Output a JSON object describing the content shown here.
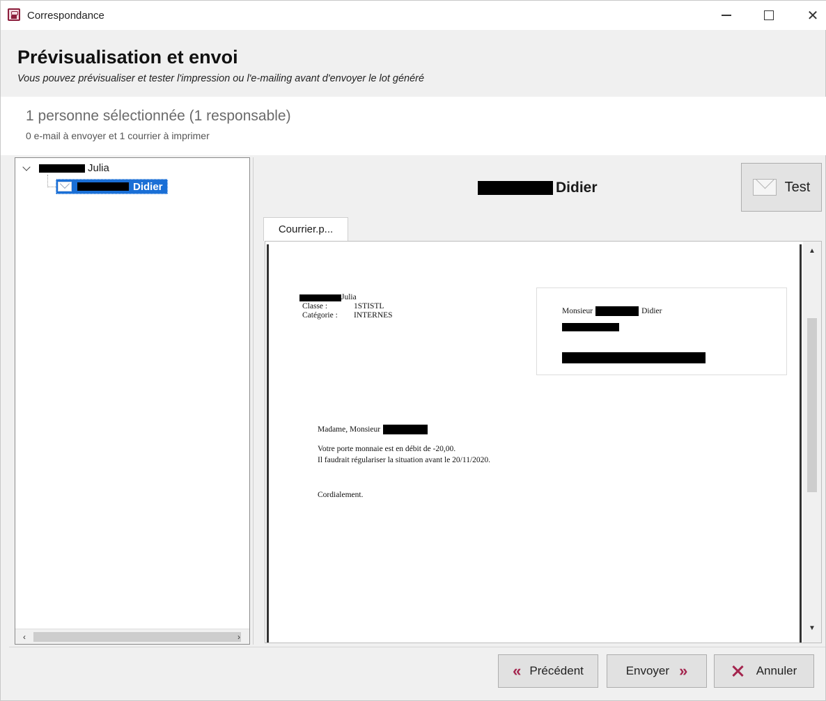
{
  "window": {
    "title": "Correspondance",
    "minimize_glyph": "",
    "close_glyph": "✕"
  },
  "header": {
    "title": "Prévisualisation et envoi",
    "subtitle": "Vous pouvez prévisualiser et tester l'impression ou l'e-mailing avant d'envoyer le lot généré"
  },
  "summary": {
    "main": "1 personne sélectionnée (1 responsable)",
    "detail": "0 e-mail à envoyer et 1 courrier à imprimer"
  },
  "tree": {
    "parent_label": "Julia",
    "child_label": "Didier",
    "scroll_left": "‹",
    "scroll_right": "›"
  },
  "preview": {
    "recipient_name": "Didier",
    "test_label": "Test",
    "tab_label": "Courrier.p...",
    "scroll_up": "▲",
    "scroll_down": "▼"
  },
  "document": {
    "sender_name": "Julia",
    "class_label": "Classe :",
    "class_value": "1STISTL",
    "category_label": "Catégorie :",
    "category_value": "INTERNES",
    "addressee_prefix": "Monsieur",
    "addressee_name": "Didier",
    "greeting": "Madame, Monsieur",
    "line1": "Votre porte monnaie est en débit de -20,00.",
    "line2": "Il faudrait régulariser la situation avant le 20/11/2020.",
    "closing": "Cordialement."
  },
  "footer": {
    "prev_label": "Précédent",
    "send_label": "Envoyer",
    "cancel_label": "Annuler"
  },
  "colors": {
    "selection": "#1a6fd6",
    "accent": "#a4254e"
  }
}
